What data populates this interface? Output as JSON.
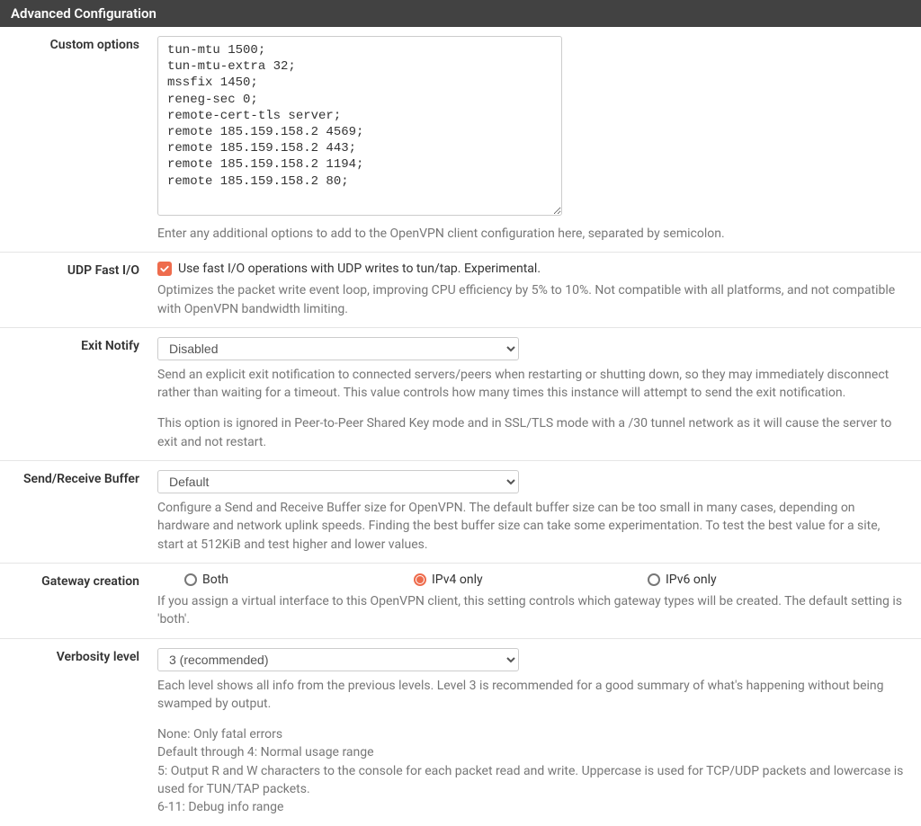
{
  "panel": {
    "title": "Advanced Configuration"
  },
  "customOptions": {
    "label": "Custom options",
    "value": "tun-mtu 1500;\ntun-mtu-extra 32;\nmssfix 1450;\nreneg-sec 0;\nremote-cert-tls server;\nremote 185.159.158.2 4569;\nremote 185.159.158.2 443;\nremote 185.159.158.2 1194;\nremote 185.159.158.2 80;",
    "help": "Enter any additional options to add to the OpenVPN client configuration here, separated by semicolon."
  },
  "udpFastIO": {
    "label": "UDP Fast I/O",
    "checkboxLabel": "Use fast I/O operations with UDP writes to tun/tap. Experimental.",
    "checked": true,
    "help": "Optimizes the packet write event loop, improving CPU efficiency by 5% to 10%. Not compatible with all platforms, and not compatible with OpenVPN bandwidth limiting."
  },
  "exitNotify": {
    "label": "Exit Notify",
    "selected": "Disabled",
    "help1": "Send an explicit exit notification to connected servers/peers when restarting or shutting down, so they may immediately disconnect rather than waiting for a timeout. This value controls how many times this instance will attempt to send the exit notification.",
    "help2": "This option is ignored in Peer-to-Peer Shared Key mode and in SSL/TLS mode with a /30 tunnel network as it will cause the server to exit and not restart."
  },
  "sendReceiveBuffer": {
    "label": "Send/Receive Buffer",
    "selected": "Default",
    "help": "Configure a Send and Receive Buffer size for OpenVPN. The default buffer size can be too small in many cases, depending on hardware and network uplink speeds. Finding the best buffer size can take some experimentation. To test the best value for a site, start at 512KiB and test higher and lower values."
  },
  "gatewayCreation": {
    "label": "Gateway creation",
    "options": {
      "both": "Both",
      "ipv4": "IPv4 only",
      "ipv6": "IPv6 only"
    },
    "selected": "ipv4",
    "help": "If you assign a virtual interface to this OpenVPN client, this setting controls which gateway types will be created. The default setting is 'both'."
  },
  "verbosityLevel": {
    "label": "Verbosity level",
    "selected": "3 (recommended)",
    "help1": "Each level shows all info from the previous levels. Level 3 is recommended for a good summary of what's happening without being swamped by output.",
    "help2": "None: Only fatal errors",
    "help3": "Default through 4: Normal usage range",
    "help4": "5: Output R and W characters to the console for each packet read and write. Uppercase is used for TCP/UDP packets and lowercase is used for TUN/TAP packets.",
    "help5": "6-11: Debug info range"
  }
}
